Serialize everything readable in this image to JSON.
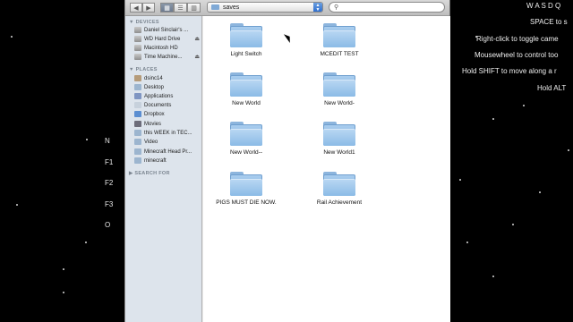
{
  "hud": {
    "left_keys": [
      "N",
      "F1",
      "F2",
      "F3",
      "O"
    ],
    "right_lines": [
      "W A S D Q",
      "SPACE to s",
      "Right-click to toggle came",
      "Mousewheel to control too",
      "Hold SHIFT to move along a r",
      "Hold ALT"
    ]
  },
  "finder": {
    "path": "saves",
    "search_placeholder": "",
    "nav": {
      "back": "◀",
      "forward": "▶"
    },
    "views": [
      "▦",
      "☰",
      "▥"
    ],
    "sidebar": {
      "devices_heading": "DEVICES",
      "devices": [
        "Daniel Sinclair's ...",
        "WD Hard Drive",
        "Macintosh HD",
        "Time Machine..."
      ],
      "places_heading": "PLACES",
      "places": [
        "dsinc14",
        "Desktop",
        "Applications",
        "Documents",
        "Dropbox",
        "Movies",
        "this WEEK in TEC...",
        "Video",
        "Minecraft Head Pr...",
        "minecraft"
      ],
      "search_heading": "SEARCH FOR"
    },
    "folders": [
      "Light Switch",
      "MCEDIT TEST",
      "New World",
      "New World-",
      "New World--",
      "New World1",
      "PIGS MUST DIE NOW.",
      "Rail Achievement"
    ]
  }
}
